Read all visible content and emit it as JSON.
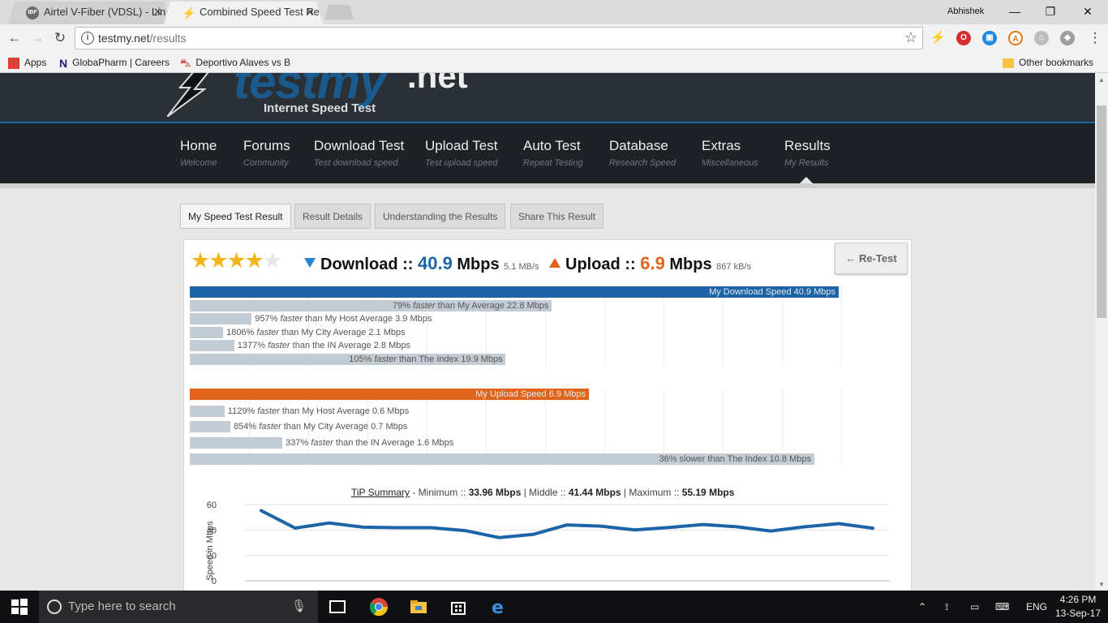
{
  "browser": {
    "tabs": [
      {
        "favicon": "IBF",
        "title": "Airtel V-Fiber (VDSL) - Lin",
        "close": "✕"
      },
      {
        "favicon": "bolt",
        "title": "Combined Speed Test Re",
        "close": "✕"
      }
    ],
    "profile_name": "Abhishek",
    "window_controls": {
      "minimize": "—",
      "maximize": "❐",
      "close": "✕"
    },
    "address": {
      "host": "testmy.net",
      "path": "/results",
      "info_icon": "i"
    },
    "bookmarks": [
      {
        "icon": "apps-grid-icon",
        "label": "Apps"
      },
      {
        "icon": "n-logo-icon",
        "label": "GlobaPharm | Careers"
      },
      {
        "icon": "car-icon",
        "label": "Deportivo Alaves vs B"
      }
    ],
    "other_bookmarks": "Other bookmarks"
  },
  "site": {
    "logo_word": "testmy",
    "logo_tld": ".net",
    "logo_sub": "Internet Speed Test",
    "nav": [
      {
        "label": "Home",
        "sub": "Welcome"
      },
      {
        "label": "Forums",
        "sub": "Community"
      },
      {
        "label": "Download Test",
        "sub": "Test download speed"
      },
      {
        "label": "Upload Test",
        "sub": "Test upload speed"
      },
      {
        "label": "Auto Test",
        "sub": "Repeat Testing"
      },
      {
        "label": "Database",
        "sub": "Research Speed"
      },
      {
        "label": "Extras",
        "sub": "Miscellaneous"
      },
      {
        "label": "Results",
        "sub": "My Results"
      }
    ],
    "result_tabs": [
      "My Speed Test Result",
      "Result Details",
      "Understanding the Results",
      "Share This Result"
    ]
  },
  "result": {
    "stars_filled": 4,
    "stars_total": 5,
    "download": {
      "label": "Download ::",
      "value": "40.9",
      "unit": "Mbps",
      "alt": "5.1 MB/s"
    },
    "upload": {
      "label": "Upload ::",
      "value": "6.9",
      "unit": "Mbps",
      "alt": "867 kB/s"
    },
    "retest": "← Re-Test",
    "colors": {
      "download": "#1c64a8",
      "upload": "#e0651b",
      "compare": "#c3ccd4"
    },
    "download_bars": [
      {
        "value": 40.9,
        "text": "My Download Speed 40.9 Mbps"
      },
      {
        "value": 22.8,
        "pct": "79%",
        "kind": "faster",
        "rest": "than My Average 22.8 Mbps"
      },
      {
        "value": 3.9,
        "pct": "957%",
        "kind": "faster",
        "rest": "than My Host Average 3.9 Mbps"
      },
      {
        "value": 2.1,
        "pct": "1806%",
        "kind": "faster",
        "rest": "than My City Average 2.1 Mbps"
      },
      {
        "value": 2.8,
        "pct": "1377%",
        "kind": "faster",
        "rest": "than the IN Average 2.8 Mbps"
      },
      {
        "value": 19.9,
        "pct": "105%",
        "kind": "faster",
        "rest": "than The Index 19.9 Mbps"
      }
    ],
    "upload_bars": [
      {
        "value": 6.9,
        "text": "My Upload Speed 6.9 Mbps"
      },
      {
        "value": 0.6,
        "pct": "1129%",
        "kind": "faster",
        "rest": "than My Host Average 0.6 Mbps"
      },
      {
        "value": 0.7,
        "pct": "854%",
        "kind": "faster",
        "rest": "than My City Average 0.7 Mbps"
      },
      {
        "value": 1.6,
        "pct": "337%",
        "kind": "faster",
        "rest": "than the IN Average 1.6 Mbps"
      },
      {
        "value": 10.8,
        "text": "36% slower than The Index 10.8 Mbps"
      }
    ],
    "tip": {
      "link": "TiP Summary",
      "min_label": " - Minimum :: ",
      "min": "33.96 Mbps",
      "mid_label": " | Middle :: ",
      "mid": "41.44 Mbps",
      "max_label": " | Maximum :: ",
      "max": "55.19 Mbps"
    }
  },
  "chart_data": {
    "type": "line",
    "ylabel": "Speed in Mbps",
    "xlabel": "",
    "ylim": [
      0,
      60
    ],
    "yticks": [
      0,
      20,
      40,
      60
    ],
    "grid": true,
    "series": [
      {
        "values": [
          55.2,
          41.5,
          45.5,
          42.2,
          41.8,
          41.8,
          39.5,
          34.0,
          36.5,
          44.0,
          43.0,
          40.0,
          42.0,
          44.3,
          42.5,
          39.2,
          42.5,
          45.0,
          41.4
        ],
        "color": "#1c64a8"
      }
    ]
  },
  "taskbar": {
    "search_placeholder": "Type here to search",
    "language": "ENG",
    "time": "4:26 PM",
    "date": "13-Sep-17"
  }
}
